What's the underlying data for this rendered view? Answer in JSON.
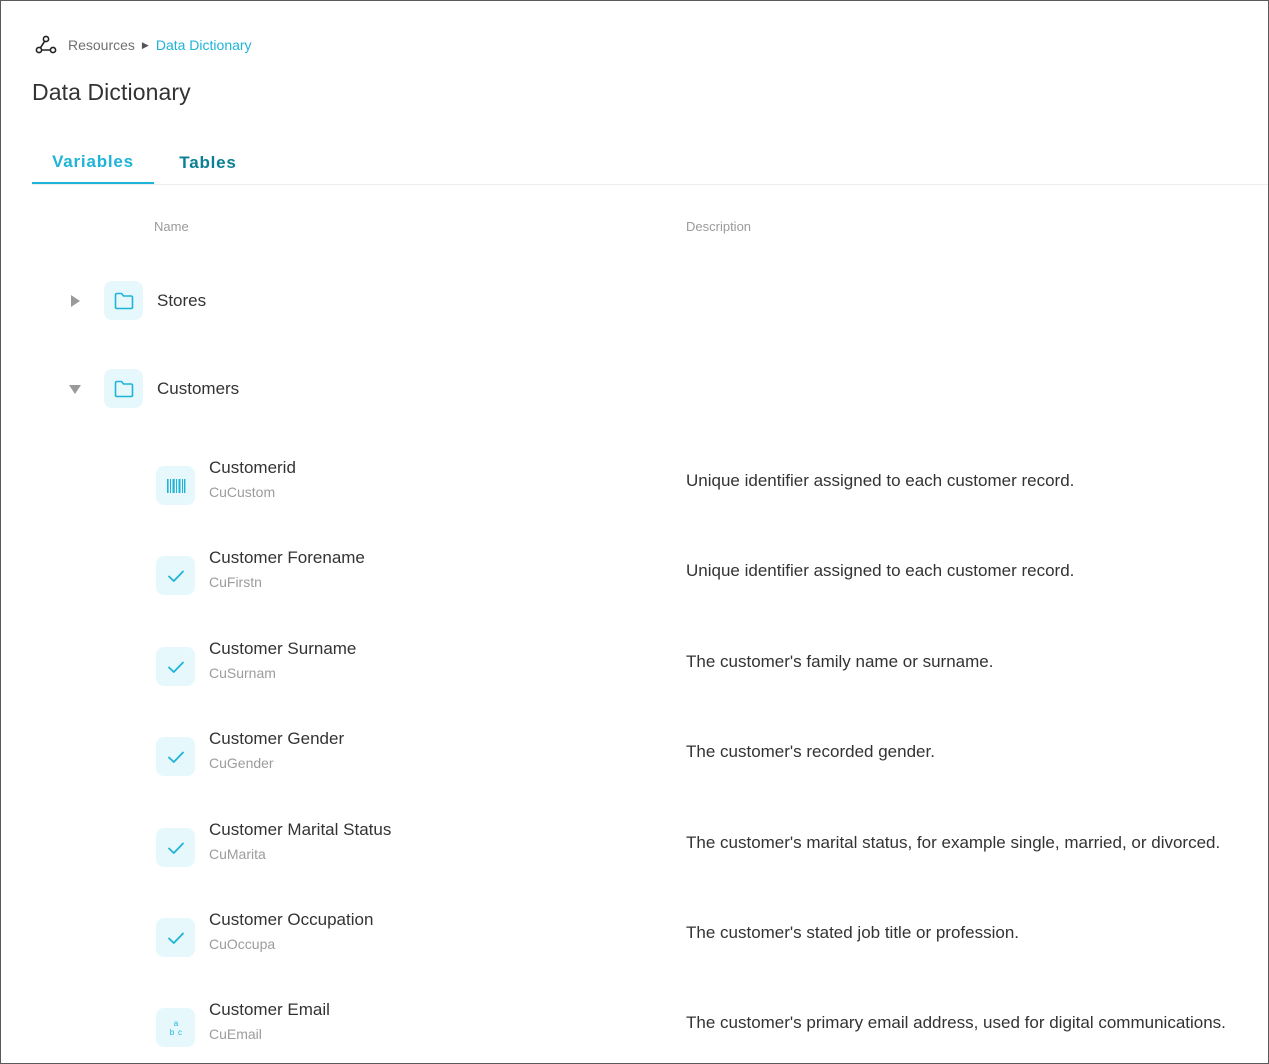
{
  "breadcrumb": {
    "home_icon": "network-nodes-icon",
    "items": [
      "Resources",
      "Data Dictionary"
    ],
    "separator_icon": "triangle-right-icon"
  },
  "page": {
    "title": "Data Dictionary"
  },
  "tabs": [
    {
      "label": "Variables",
      "active": true
    },
    {
      "label": "Tables",
      "active": false
    }
  ],
  "columns": {
    "name": "Name",
    "description": "Description"
  },
  "groups": [
    {
      "label": "Stores",
      "expanded": false,
      "icon": "folder-icon"
    },
    {
      "label": "Customers",
      "expanded": true,
      "icon": "folder-icon"
    }
  ],
  "variables": [
    {
      "name": "Customerid",
      "code": "CuCustom",
      "description": "Unique identifier assigned to each customer record.",
      "type_icon": "barcode-icon"
    },
    {
      "name": "Customer Forename",
      "code": "CuFirstn",
      "description": "Unique identifier assigned to each customer record.",
      "type_icon": "check-icon"
    },
    {
      "name": "Customer Surname",
      "code": "CuSurnam",
      "description": "The customer's family name or surname.",
      "type_icon": "check-icon"
    },
    {
      "name": "Customer Gender",
      "code": "CuGender",
      "description": "The customer's recorded gender.",
      "type_icon": "check-icon"
    },
    {
      "name": "Customer Marital Status",
      "code": "CuMarita",
      "description": "The customer's marital status, for example single, married, or divorced.",
      "type_icon": "check-icon"
    },
    {
      "name": "Customer Occupation",
      "code": "CuOccupa",
      "description": "The customer's stated job title or profession.",
      "type_icon": "check-icon"
    },
    {
      "name": "Customer Email",
      "code": "CuEmail",
      "description": "The customer's primary email address, used for digital communications.",
      "type_icon": "text-abc-icon"
    }
  ],
  "colors": {
    "accent": "#1eb4d8",
    "accent_dark": "#0b7f95",
    "icon_bg": "#e6f8fc",
    "text": "#333333",
    "muted": "#9c9c9c"
  }
}
